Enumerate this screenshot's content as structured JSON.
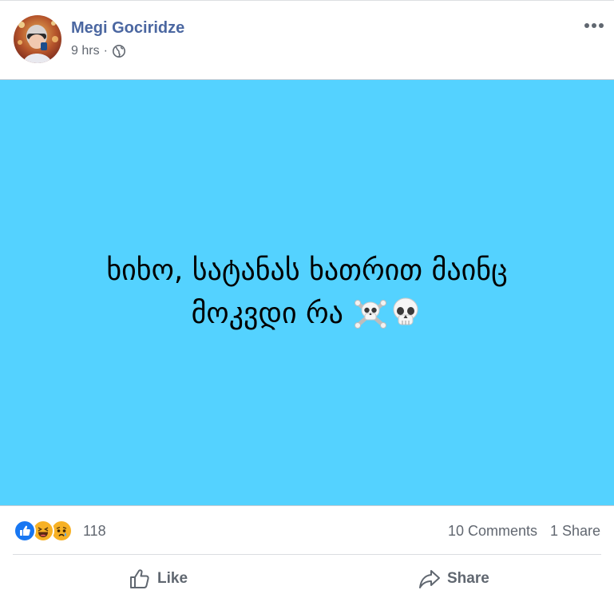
{
  "post": {
    "author": "Megi Gociridze",
    "time": "9 hrs",
    "separator": "·",
    "privacy_icon": "globe-icon",
    "options_icon": "more-options-icon"
  },
  "status": {
    "line1": "ხიხო, სატანას ხათრით მაინც",
    "line2": "მოკვდი რა",
    "emojis": [
      "skull-and-crossbones-emoji",
      "skull-emoji"
    ],
    "background_color": "#54d2ff"
  },
  "reactions": {
    "icons": [
      "like-reaction-icon",
      "haha-reaction-icon",
      "sad-reaction-icon"
    ],
    "count": "118",
    "comments": "10 Comments",
    "shares": "1 Share"
  },
  "actions": {
    "like_label": "Like",
    "share_label": "Share"
  },
  "colors": {
    "author_link": "#4b67a1",
    "meta_text": "#616770",
    "like_blue": "#1877f2",
    "emoji_yellow": "#f7b125"
  }
}
